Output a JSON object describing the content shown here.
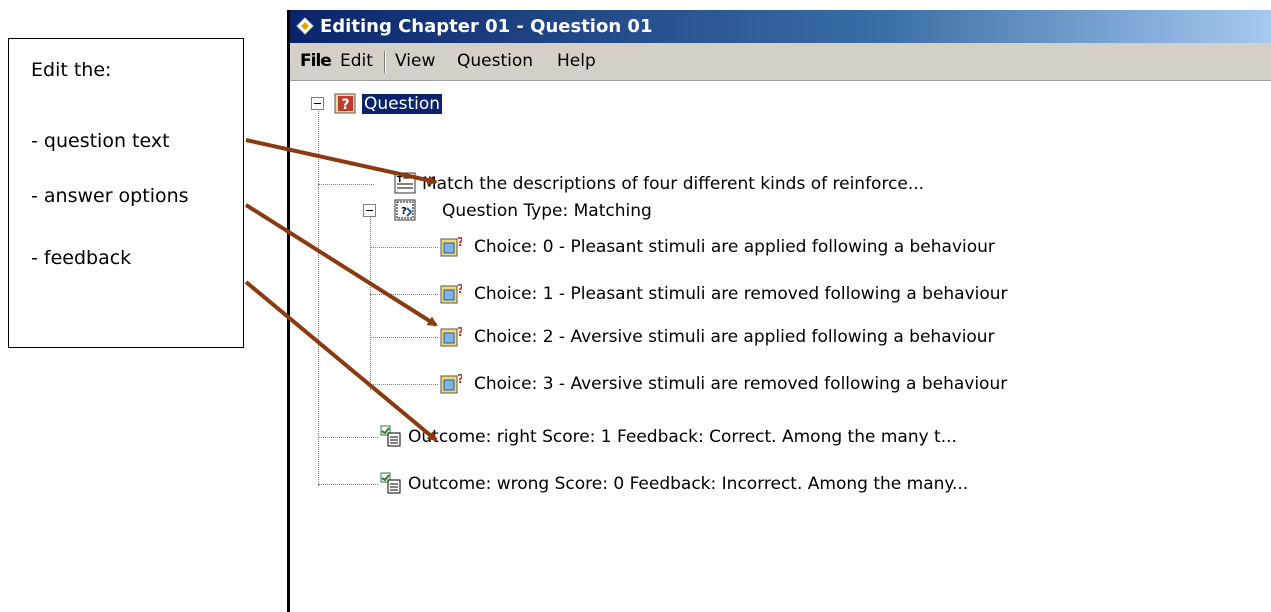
{
  "callout": {
    "heading": "Edit the:",
    "items": [
      "- question text",
      "- answer options",
      "- feedback"
    ]
  },
  "window": {
    "title": "Editing Chapter 01 - Question 01"
  },
  "menu": {
    "file": "File",
    "edit": "Edit",
    "view": "View",
    "question": "Question",
    "help": "Help"
  },
  "tree": {
    "root": "Question",
    "text": "Match the descriptions of four different kinds of reinforce...",
    "type": "Question Type: Matching",
    "choices": [
      "Choice: 0 - Pleasant stimuli are applied following a behaviour",
      "Choice: 1 - Pleasant stimuli are removed following a behaviour",
      "Choice: 2 - Aversive stimuli are applied following a behaviour",
      "Choice: 3 - Aversive stimuli are removed following a behaviour"
    ],
    "outcomes": [
      "Outcome: right Score: 1 Feedback: Correct. Among the many t...",
      "Outcome: wrong Score: 0 Feedback: Incorrect. Among the many..."
    ]
  },
  "colors": {
    "arrow": "#8b3a10",
    "title_bar": "#0a246a",
    "selection": "#0a246a",
    "question_icon": "#c0392b"
  },
  "icons": {
    "app": "diamond-app-icon",
    "root": "question-mark-icon",
    "text": "text-lines-icon",
    "type": "question-type-icon",
    "choice": "choice-icon",
    "outcome": "outcome-icon"
  }
}
